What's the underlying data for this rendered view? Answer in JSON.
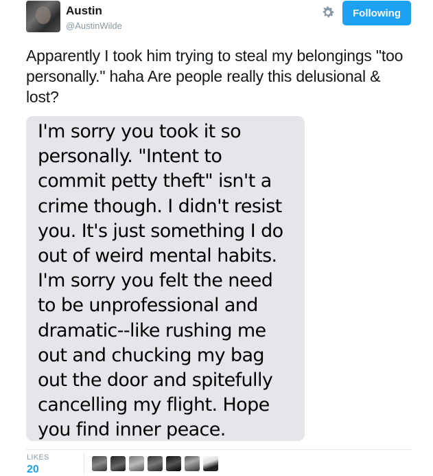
{
  "author": {
    "name": "Austin",
    "handle": "@AustinWilde"
  },
  "header": {
    "settings_icon": "gear-icon",
    "follow_label": "Following"
  },
  "tweet": {
    "text": "Apparently I took him trying to steal my belongings \"too personally.\" haha Are people really this delusional & lost?"
  },
  "message_image": {
    "text": "I'm sorry you took it so\npersonally. \"Intent to\ncommit petty theft\" isn't a\ncrime though. I didn't resist\nyou. It's just something I do\nout of weird mental habits.\nI'm sorry you felt the need\nto be unprofessional and\ndramatic--like rushing me\nout and chucking my bag\nout the door and spitefully\ncancelling my flight. Hope\nyou find inner peace."
  },
  "stats": {
    "likes_label": "LIKES",
    "likes_count": "20"
  },
  "colors": {
    "accent": "#1da1f2",
    "bubble": "#e5e5ea",
    "muted": "#8899a6"
  }
}
